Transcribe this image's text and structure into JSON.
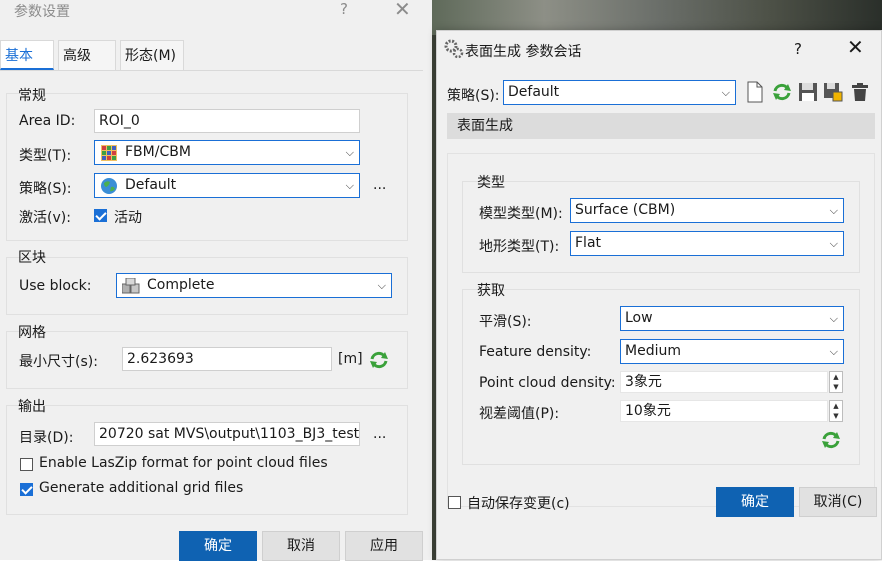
{
  "left_dialog": {
    "title": "参数设置",
    "help": "?",
    "close": "✕",
    "tabs": [
      "基本(B)",
      "高级(A)",
      "形态(M)"
    ],
    "general": {
      "title": "常规",
      "area_id_label": "Area ID:",
      "area_id_value": "ROI_0",
      "type_label": "类型(T):",
      "type_value": "FBM/CBM",
      "strategy_label": "策略(S):",
      "strategy_value": "Default",
      "strategy_more": "...",
      "active_label": "激活(v):",
      "active_checkbox_label": "活动",
      "active_checked": true
    },
    "block": {
      "title": "区块",
      "use_block_label": "Use block:",
      "use_block_value": "Complete"
    },
    "grid": {
      "title": "网格",
      "min_size_label": "最小尺寸(s):",
      "min_size_value": "2.623693",
      "unit": "[m]"
    },
    "output": {
      "title": "输出",
      "dir_label": "目录(D):",
      "dir_value": "20720 sat MVS\\output\\1103_BJ3_test",
      "dir_more": "...",
      "laszip_label": "Enable LasZip format for point cloud files",
      "laszip_checked": false,
      "grid_files_label": "Generate additional grid files",
      "grid_files_checked": true
    },
    "buttons": {
      "ok": "确定",
      "cancel": "取消",
      "apply": "应用"
    }
  },
  "right_dialog": {
    "title": "表面生成  参数会话",
    "help": "?",
    "close": "✕",
    "strategy_label": "策略(S):",
    "strategy_value": "Default",
    "subheader": "表面生成",
    "type_section": {
      "title": "类型",
      "model_type_label": "模型类型(M):",
      "model_type_value": "Surface (CBM)",
      "terrain_type_label": "地形类型(T):",
      "terrain_type_value": "Flat"
    },
    "acquire_section": {
      "title": "获取",
      "smooth_label": "平滑(S):",
      "smooth_value": "Low",
      "feature_label": "Feature density:",
      "feature_value": "Medium",
      "point_label": "Point cloud density:",
      "point_value": "3象元",
      "disparity_label": "视差阈值(P):",
      "disparity_value": "10象元"
    },
    "autosave_label": "自动保存变更(c)",
    "autosave_checked": false,
    "buttons": {
      "ok": "确定",
      "cancel": "取消(C)"
    }
  },
  "colors": {
    "accent": "#1a6fd6",
    "primary_button": "#0f62b2"
  }
}
